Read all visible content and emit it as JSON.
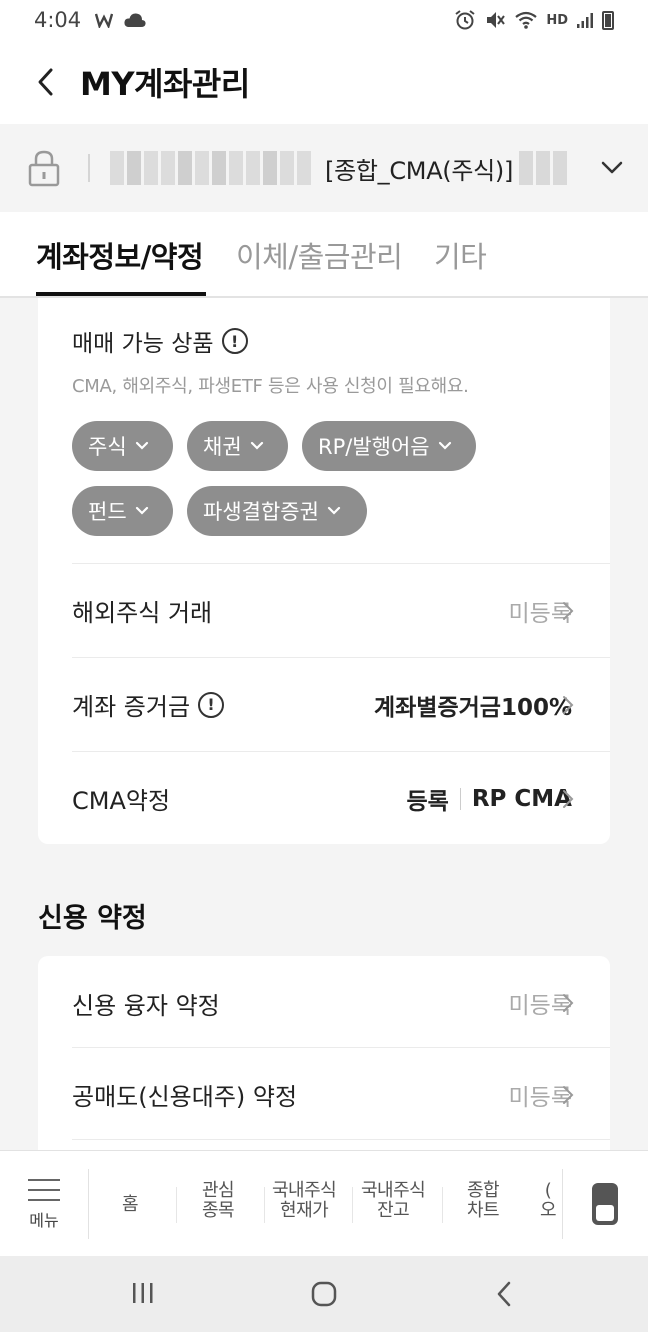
{
  "status_bar": {
    "time": "4:04",
    "app_icons": [
      "w-icon",
      "cloud-icon"
    ],
    "right_icons": [
      "alarm-icon",
      "mute-icon",
      "wifi-icon",
      "hd-voice-icon",
      "signal-icon",
      "battery-icon"
    ],
    "hd_voice": "HD"
  },
  "header": {
    "title": "MY계좌관리",
    "back_icon": "back-arrow-icon"
  },
  "account": {
    "name": "[종합_CMA(주식)]",
    "lock_icon": "lock-icon",
    "dropdown_icon": "chevron-down-icon"
  },
  "tabs": [
    {
      "label": "계좌정보/약정",
      "active": true
    },
    {
      "label": "이체/출금관리",
      "active": false
    },
    {
      "label": "기타",
      "active": false
    }
  ],
  "trade_products": {
    "title": "매매 가능 상품",
    "subtitle": "CMA, 해외주식, 파생ETF 등은 사용 신청이 필요해요.",
    "chips": [
      "주식",
      "채권",
      "RP/발행어음",
      "펀드",
      "파생결합증권"
    ]
  },
  "account_rows": [
    {
      "label": "해외주식 거래",
      "value": "미등록",
      "info": false
    },
    {
      "label": "계좌 증거금",
      "value": "계좌별증거금100%",
      "info": true
    },
    {
      "label": "CMA약정",
      "value_left": "등록",
      "value_right": "RP CMA",
      "info": false
    }
  ],
  "credit": {
    "title": "신용 약정",
    "rows": [
      {
        "label": "신용 융자 약정",
        "value": "미등록"
      },
      {
        "label": "공매도(신용대주) 약정",
        "value": "미등록"
      }
    ]
  },
  "bottom_nav": {
    "menu_label": "메뉴",
    "items": [
      {
        "line1": "홈",
        "line2": ""
      },
      {
        "line1": "관심",
        "line2": "종목"
      },
      {
        "line1": "국내주식",
        "line2": "현재가"
      },
      {
        "line1": "국내주식",
        "line2": "잔고"
      },
      {
        "line1": "종합",
        "line2": "차트"
      },
      {
        "line1": "(",
        "line2": "오"
      }
    ]
  },
  "system_nav": [
    "recents-icon",
    "home-icon",
    "back-icon"
  ],
  "colors": {
    "chip_bg": "#8e8e8e",
    "active_tab": "#111111",
    "inactive_tab": "#999999",
    "page_bg": "#f4f4f4"
  }
}
